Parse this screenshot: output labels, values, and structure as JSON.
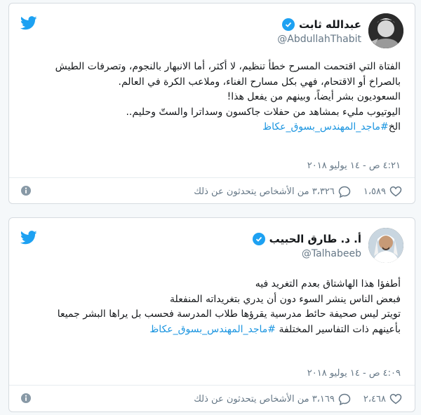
{
  "colors": {
    "twitter_blue": "#1da1f2",
    "link": "#1b95e0",
    "text": "#14171a",
    "muted": "#657786"
  },
  "tweets": [
    {
      "display_name": "عبدالله ثابت",
      "handle": "@AbdullahThabit",
      "lines": [
        "الفتاة التي اقتحمت المسرح خطأ تنظيم، لا أكثر، أما الانبهار بالنجوم، وتصرفات الطيش",
        "بالصراخ أو الاقتحام، فهي بكل مسارح الغناء، وملاعب الكرة في العالم.",
        "السعوديون بشر أيضاً، وبينهم من يفعل هذا!",
        "اليوتيوب مليء بمشاهد من حفلات جاكسون وسداترا والستّ وحليم..",
        "الخ"
      ],
      "hashtag": "#ماجد_المهندس_بسوق_عكاظ",
      "timestamp": "٤:٢١ ص - ١٤ يوليو ٢٠١٨",
      "likes": "١،٥٨٩",
      "replies": "٣،٣٢٦ من الأشخاص يتحدثون عن ذلك",
      "icons": {
        "brand": "twitter-bird-icon",
        "verified": "verified-badge-icon",
        "like": "heart-icon",
        "reply": "reply-bubble-icon",
        "info": "info-icon"
      }
    },
    {
      "display_name": "أ. د. طارق الحبيب",
      "handle": "@Talhabeeb",
      "lines": [
        "أطفؤا هذا الهاشتاق بعدم التغريد فيه",
        "فبعض الناس ينشر السوء دون أن يدري بتغريداته المنفعلة",
        "تويتر ليس صحيفة حائط مدرسية يقرؤها طلاب المدرسة فحسب بل يراها البشر جميعا",
        "بأعينهم ذات التفاسير المختلفة"
      ],
      "hashtag": "#ماجد_المهندس_بسوق_عكاظ",
      "timestamp": "٤:٠٩ ص - ١٤ يوليو ٢٠١٨",
      "likes": "٢،٤٦٨",
      "replies": "٣،١٦٩ من الأشخاص يتحدثون عن ذلك",
      "icons": {
        "brand": "twitter-bird-icon",
        "verified": "verified-badge-icon",
        "like": "heart-icon",
        "reply": "reply-bubble-icon",
        "info": "info-icon"
      }
    }
  ]
}
